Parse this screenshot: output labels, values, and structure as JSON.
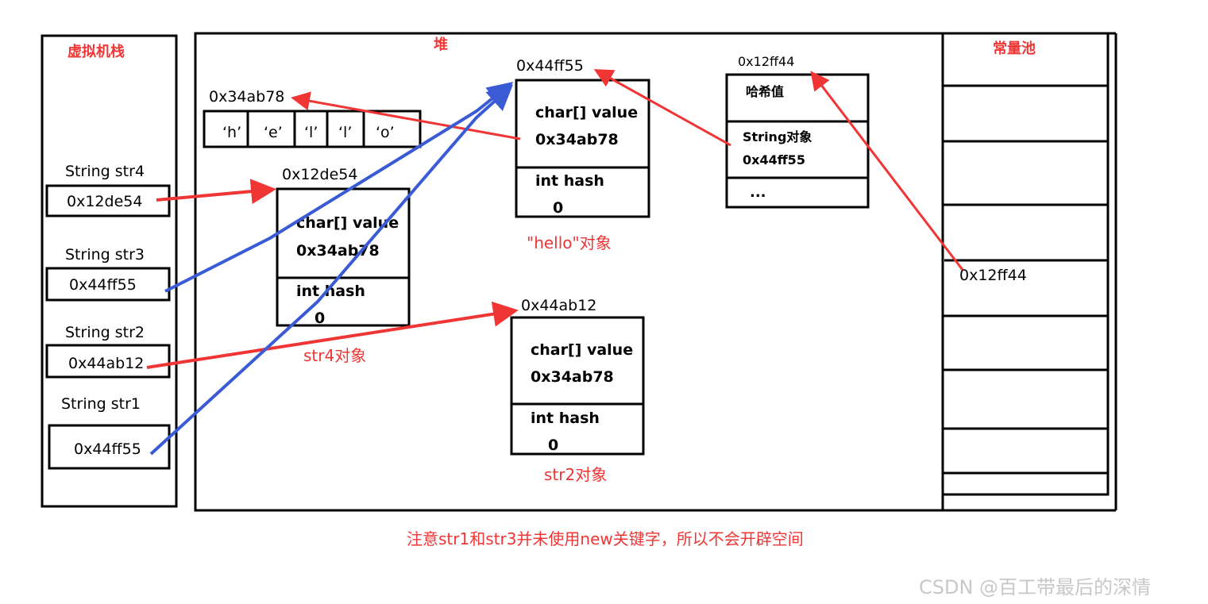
{
  "stack": {
    "title": "虚拟机栈",
    "vars": [
      {
        "label": "String str4",
        "value": "0x12de54"
      },
      {
        "label": "String str3",
        "value": "0x44ff55"
      },
      {
        "label": "String str2",
        "value": "0x44ab12"
      },
      {
        "label": "String str1",
        "value": "0x44ff55"
      }
    ]
  },
  "heap": {
    "title": "堆",
    "char_array": {
      "address": "0x34ab78",
      "chars": [
        "‘h’",
        "‘e’",
        "‘l’",
        "‘l’",
        "‘o’"
      ]
    },
    "str4_obj": {
      "address": "0x12de54",
      "value_label": "char[] value",
      "value": "0x34ab78",
      "hash_label": "int hash",
      "hash": "0",
      "caption": "str4对象"
    },
    "hello_obj": {
      "address": "0x44ff55",
      "value_label": "char[] value",
      "value": "0x34ab78",
      "hash_label": "int hash",
      "hash": "0",
      "caption": "\"hello\"对象"
    },
    "str2_obj": {
      "address": "0x44ab12",
      "value_label": "char[] value",
      "value": "0x34ab78",
      "hash_label": "int hash",
      "hash": "0",
      "caption": "str2对象"
    },
    "table": {
      "address": "0x12ff44",
      "hash_label": "哈希值",
      "entry_label": "String对象",
      "entry_value": "0x44ff55",
      "more": "..."
    }
  },
  "pool": {
    "title": "常量池",
    "entry": "0x12ff44"
  },
  "note": "注意str1和str3并未使用new关键字，所以不会开辟空间",
  "watermark": "CSDN @百工带最后的深情",
  "colors": {
    "red": "#f03535",
    "blue": "#3a5bd4"
  }
}
